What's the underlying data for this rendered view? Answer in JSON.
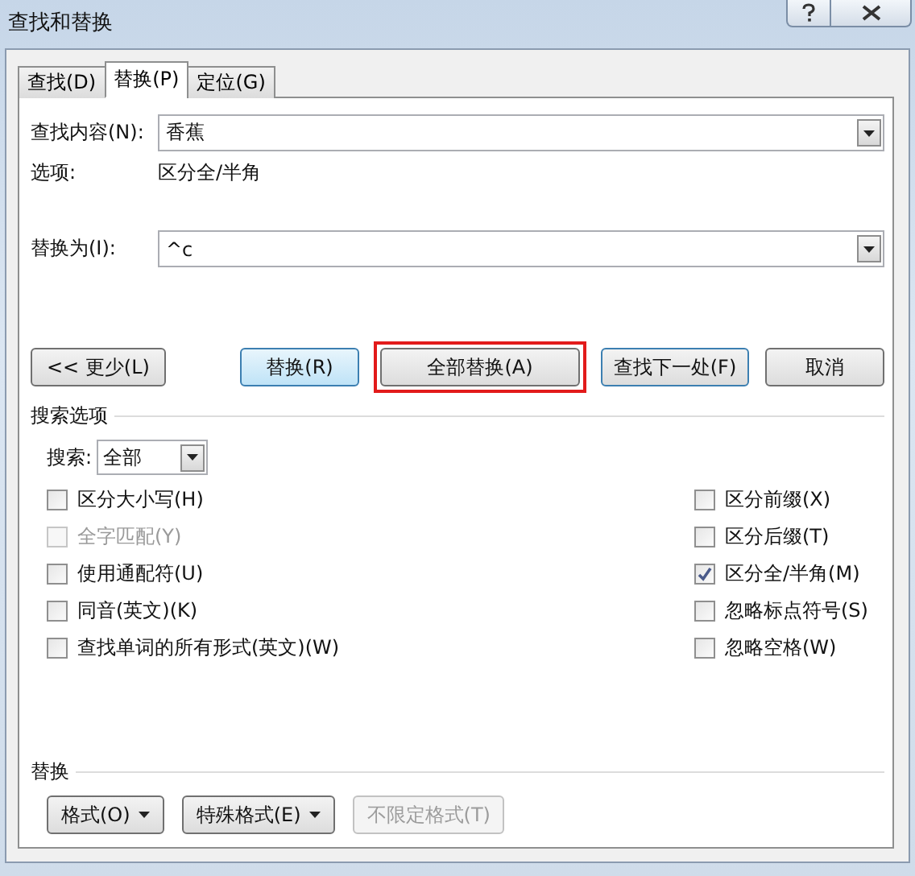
{
  "window": {
    "title": "查找和替换"
  },
  "tabs": [
    {
      "label": "查找(D)",
      "selected": false
    },
    {
      "label": "替换(P)",
      "selected": true
    },
    {
      "label": "定位(G)",
      "selected": false
    }
  ],
  "find": {
    "label": "查找内容(N):",
    "value": "香蕉"
  },
  "options": {
    "label": "选项:",
    "value": "区分全/半角"
  },
  "replace": {
    "label": "替换为(I):",
    "value": "^c"
  },
  "action_buttons": [
    {
      "label": "<< 更少(L)",
      "kind": "normal"
    },
    {
      "label": "替换(R)",
      "kind": "default"
    },
    {
      "label": "全部替换(A)",
      "kind": "marked"
    },
    {
      "label": "查找下一处(F)",
      "kind": "focused"
    },
    {
      "label": "取消",
      "kind": "normal"
    }
  ],
  "search_options": {
    "title": "搜索选项",
    "search_label": "搜索:",
    "search_value": "全部",
    "left": [
      {
        "label": "区分大小写(H)",
        "checked": false,
        "disabled": false
      },
      {
        "label": "全字匹配(Y)",
        "checked": false,
        "disabled": true
      },
      {
        "label": "使用通配符(U)",
        "checked": false,
        "disabled": false
      },
      {
        "label": "同音(英文)(K)",
        "checked": false,
        "disabled": false
      },
      {
        "label": "查找单词的所有形式(英文)(W)",
        "checked": false,
        "disabled": false
      }
    ],
    "right": [
      {
        "label": "区分前缀(X)",
        "checked": false,
        "disabled": false
      },
      {
        "label": "区分后缀(T)",
        "checked": false,
        "disabled": false
      },
      {
        "label": "区分全/半角(M)",
        "checked": true,
        "disabled": false
      },
      {
        "label": "忽略标点符号(S)",
        "checked": false,
        "disabled": false
      },
      {
        "label": "忽略空格(W)",
        "checked": false,
        "disabled": false
      }
    ]
  },
  "replace_section": {
    "title": "替换",
    "buttons": [
      {
        "label": "格式(O)",
        "menu": true,
        "disabled": false
      },
      {
        "label": "特殊格式(E)",
        "menu": true,
        "disabled": false
      },
      {
        "label": "不限定格式(T)",
        "menu": false,
        "disabled": true
      }
    ]
  }
}
